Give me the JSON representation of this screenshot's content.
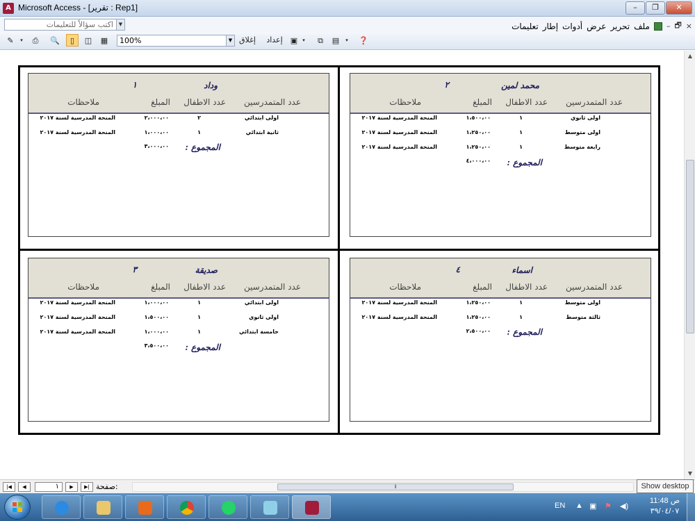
{
  "window": {
    "title": "Microsoft Access - [تقرير : Rep1]",
    "controls": {
      "minimize": "–",
      "restore": "❐",
      "close": "✕"
    }
  },
  "menubar": {
    "ask_placeholder": "اكتب سؤالاً للتعليمات",
    "items": [
      "ملف",
      "تحرير",
      "عرض",
      "أدوات",
      "إطار",
      "تعليمات"
    ],
    "mdi_controls": {
      "close": "×",
      "restore": "🗗",
      "minimize": "–"
    }
  },
  "toolbar": {
    "zoom": "100%",
    "setup_label": "إعداد",
    "close_label": "إغلاق"
  },
  "columns": {
    "trainees": "عدد المتمدرسين",
    "children": "عدد الاطفال",
    "amount": "المبلغ",
    "notes": "ملاحظات"
  },
  "total_label": "المجموع :",
  "cards": [
    {
      "name": "محمد لمين",
      "number": "٢",
      "rows": [
        {
          "level": "اولى ثانوي",
          "children": "١",
          "amount": "١،٥٠٠،٠٠",
          "notes": "المنحة المدرسية لسنة ٢٠١٧"
        },
        {
          "level": "اولى متوسط",
          "children": "١",
          "amount": "١،٢٥٠،٠٠",
          "notes": "المنحة المدرسية لسنة ٢٠١٧"
        },
        {
          "level": "رابعة متوسط",
          "children": "١",
          "amount": "١،٢٥٠،٠٠",
          "notes": "المنحة المدرسية لسنة ٢٠١٧"
        }
      ],
      "total": "٤،٠٠٠،٠٠"
    },
    {
      "name": "وداد",
      "number": "١",
      "rows": [
        {
          "level": "اولى ابتدائي",
          "children": "٢",
          "amount": "٢،٠٠٠،٠٠",
          "notes": "المنحة المدرسية لسنة ٢٠١٧"
        },
        {
          "level": "ثانية ابتدائي",
          "children": "١",
          "amount": "١،٠٠٠،٠٠",
          "notes": "المنحة المدرسية لسنة ٢٠١٧"
        }
      ],
      "total": "٣،٠٠٠،٠٠"
    },
    {
      "name": "اسماء",
      "number": "٤",
      "rows": [
        {
          "level": "اولى متوسط",
          "children": "١",
          "amount": "١،٢٥٠،٠٠",
          "notes": "المنحة المدرسية لسنة ٢٠١٧"
        },
        {
          "level": "ثالثة متوسط",
          "children": "١",
          "amount": "١،٢٥٠،٠٠",
          "notes": "المنحة المدرسية لسنة ٢٠١٧"
        }
      ],
      "total": "٢،٥٠٠،٠٠"
    },
    {
      "name": "صديقة",
      "number": "٣",
      "rows": [
        {
          "level": "اولى ابتدائي",
          "children": "١",
          "amount": "١،٠٠٠،٠٠",
          "notes": "المنحة المدرسية لسنة ٢٠١٧"
        },
        {
          "level": "اولى ثانوي",
          "children": "١",
          "amount": "١،٥٠٠،٠٠",
          "notes": "المنحة المدرسية لسنة ٢٠١٧"
        },
        {
          "level": "خامسة ابتدائي",
          "children": "١",
          "amount": "١،٠٠٠،٠٠",
          "notes": "المنحة المدرسية لسنة ٢٠١٧"
        }
      ],
      "total": "٣،٥٠٠،٠٠"
    }
  ],
  "nav": {
    "page_label": "صفحة:",
    "page_number": "١"
  },
  "tooltip": "Show desktop",
  "taskbar": {
    "language": "EN",
    "time": "11:48 ص",
    "date": "٣٩/٠٤/٠٧",
    "apps": [
      "internet-explorer",
      "file-explorer",
      "media-player",
      "chrome",
      "whatsapp",
      "notepad",
      "access"
    ]
  }
}
